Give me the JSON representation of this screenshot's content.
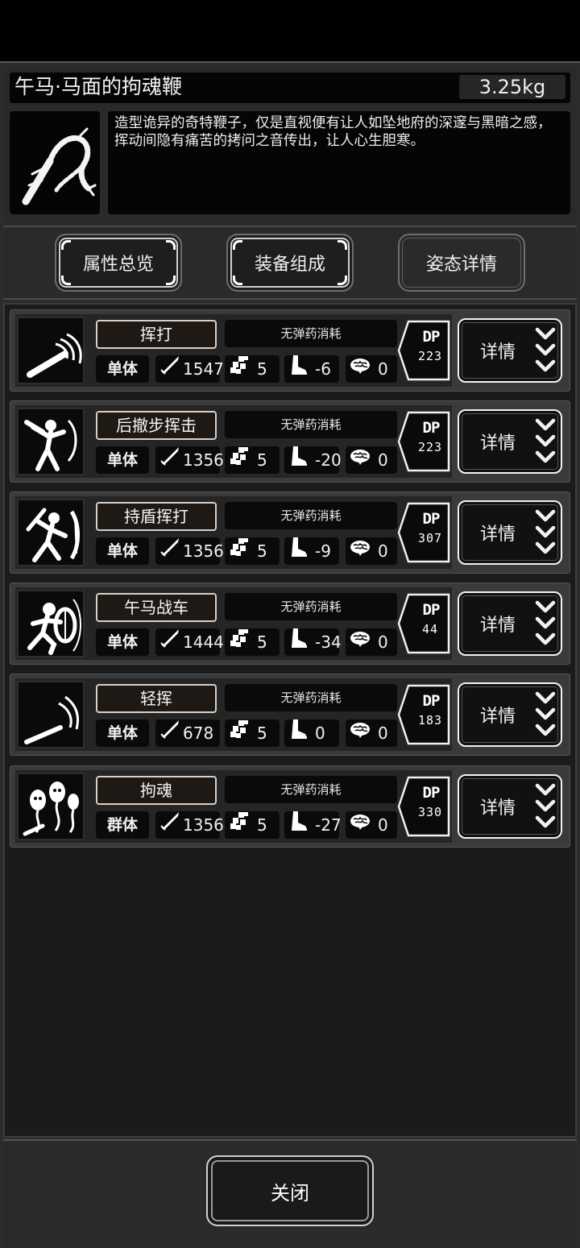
{
  "item": {
    "title": "午马·马面的拘魂鞭",
    "weight": "3.25kg",
    "description": "造型诡异的奇特鞭子，仅是直视便有让人如坠地府的深邃与黑暗之感，挥动间隐有痛苦的拷问之音传出，让人心生胆寒。",
    "icon": "scorpion-whip-icon"
  },
  "tabs": [
    {
      "label": "属性总览",
      "active": false
    },
    {
      "label": "装备组成",
      "active": false
    },
    {
      "label": "姿态详情",
      "active": true
    }
  ],
  "skills": [
    {
      "name": "挥打",
      "ammo": "无弹药消耗",
      "target": "单体",
      "attack": "1547",
      "range": "5",
      "move": "-6",
      "brain": "0",
      "dp_label": "DP",
      "dp": "223",
      "detail": "详情",
      "icon": "swing-strike-icon"
    },
    {
      "name": "后撤步挥击",
      "ammo": "无弹药消耗",
      "target": "单体",
      "attack": "1356",
      "range": "5",
      "move": "-20",
      "brain": "0",
      "dp_label": "DP",
      "dp": "223",
      "detail": "详情",
      "icon": "backstep-swing-icon"
    },
    {
      "name": "持盾挥打",
      "ammo": "无弹药消耗",
      "target": "单体",
      "attack": "1356",
      "range": "5",
      "move": "-9",
      "brain": "0",
      "dp_label": "DP",
      "dp": "307",
      "detail": "详情",
      "icon": "shield-swing-icon"
    },
    {
      "name": "午马战车",
      "ammo": "无弹药消耗",
      "target": "单体",
      "attack": "1444",
      "range": "5",
      "move": "-34",
      "brain": "0",
      "dp_label": "DP",
      "dp": "44",
      "detail": "详情",
      "icon": "shield-charge-icon"
    },
    {
      "name": "轻挥",
      "ammo": "无弹药消耗",
      "target": "单体",
      "attack": "678",
      "range": "5",
      "move": "0",
      "brain": "0",
      "dp_label": "DP",
      "dp": "183",
      "detail": "详情",
      "icon": "light-swing-icon"
    },
    {
      "name": "拘魂",
      "ammo": "无弹药消耗",
      "target": "群体",
      "attack": "1356",
      "range": "5",
      "move": "-27",
      "brain": "0",
      "dp_label": "DP",
      "dp": "330",
      "detail": "详情",
      "icon": "soul-capture-icon"
    }
  ],
  "close_label": "关闭"
}
